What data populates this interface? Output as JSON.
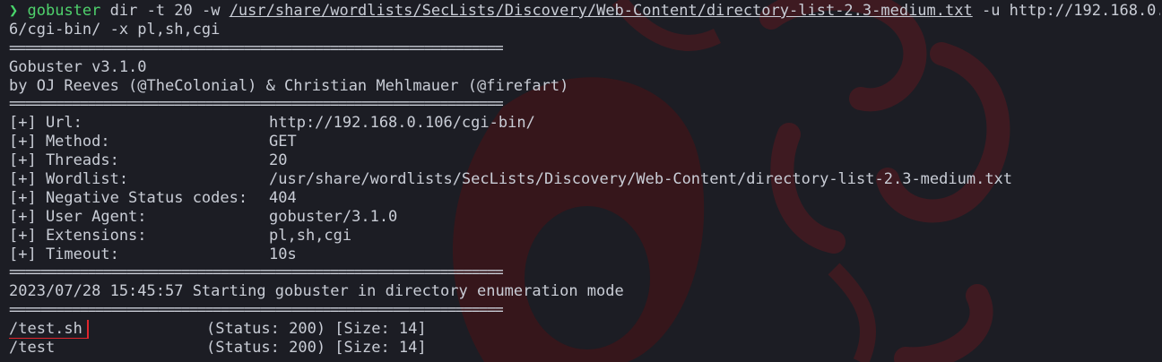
{
  "prompt": {
    "symbol": "❯",
    "command": "gobuster",
    "args_1": " dir -t 20 -w ",
    "wordlist_path": "/usr/share/wordlists/SecLists/Discovery/Web-Content/directory-list-2.3-medium.txt",
    "args_2": " -u http://192.168.0.10",
    "wrap": "6/cgi-bin/ -x pl,sh,cgi"
  },
  "separator": "===============================================================",
  "banner": {
    "version": "Gobuster v3.1.0",
    "authors": "by OJ Reeves (@TheColonial) & Christian Mehlmauer (@firefart)"
  },
  "config": [
    {
      "key": "[+] Url:",
      "value": "http://192.168.0.106/cgi-bin/"
    },
    {
      "key": "[+] Method:",
      "value": "GET"
    },
    {
      "key": "[+] Threads:",
      "value": "20"
    },
    {
      "key": "[+] Wordlist:",
      "value": "/usr/share/wordlists/SecLists/Discovery/Web-Content/directory-list-2.3-medium.txt"
    },
    {
      "key": "[+] Negative Status codes:",
      "value": "404"
    },
    {
      "key": "[+] User Agent:",
      "value": "gobuster/3.1.0"
    },
    {
      "key": "[+] Extensions:",
      "value": "pl,sh,cgi"
    },
    {
      "key": "[+] Timeout:",
      "value": "10s"
    }
  ],
  "start_message": "2023/07/28 15:45:57 Starting gobuster in directory enumeration mode",
  "results": [
    {
      "path": "/test.sh",
      "info": "(Status: 200) [Size: 14]",
      "highlighted": true
    },
    {
      "path": "/test",
      "info": "(Status: 200) [Size: 14]",
      "highlighted": false
    }
  ],
  "colors": {
    "background": "#1c1d24",
    "foreground": "#c9cdd6",
    "prompt_green": "#49d66b",
    "highlight_red": "#e0262d",
    "wallpaper_red": "#5a1c22"
  }
}
